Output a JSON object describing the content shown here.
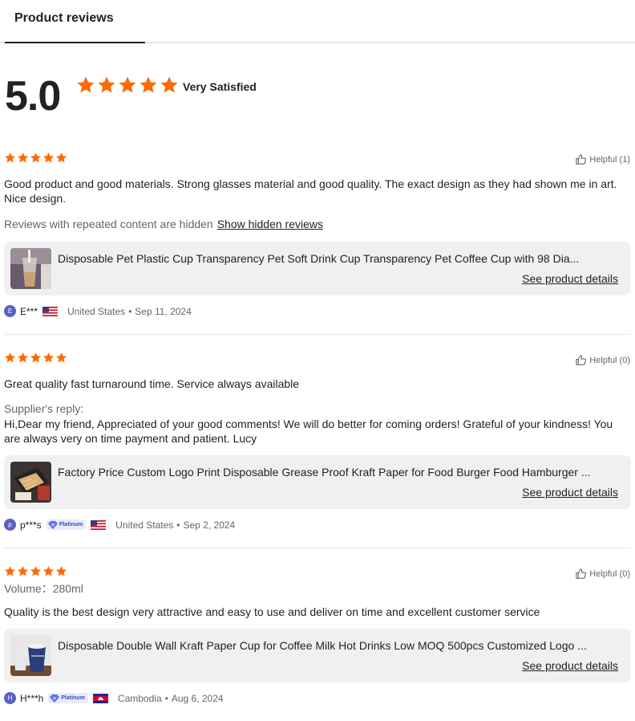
{
  "tabs": {
    "active": "Product reviews"
  },
  "summary": {
    "score": "5.0",
    "stars": 5,
    "label": "Very Satisfied"
  },
  "colors": {
    "star": "#ff6a00",
    "text": "#222222",
    "muted": "#666666",
    "card": "#f0f0f0"
  },
  "reviews": [
    {
      "stars": 5,
      "helpful": "Helpful (1)",
      "text": "Good product and good materials. Strong glasses material and good quality. The exact design as they had shown me in art. Nice design.",
      "hidden_note": "Reviews with repeated content are hidden",
      "hidden_link": "Show hidden reviews",
      "product": {
        "title": "Disposable Pet Plastic Cup Transparency Pet Soft Drink Cup Transparency Pet Coffee Cup with 98 Dia...",
        "link": "See product details"
      },
      "user": {
        "initial": "E",
        "name": "E***",
        "country": "United States",
        "date": "Sep 11, 2024"
      }
    },
    {
      "stars": 5,
      "helpful": "Helpful (0)",
      "text": "Great quality fast turnaround time. Service always available",
      "reply_label": "Supplier's reply:",
      "reply_text": "Hi,Dear my friend, Appreciated of your good comments! We will do better for coming orders! Grateful of your kindness! You are always very on time payment and patient. Lucy",
      "product": {
        "title": "Factory Price Custom Logo Print Disposable Grease Proof Kraft Paper for Food Burger Food Hamburger ...",
        "link": "See product details"
      },
      "user": {
        "initial": "p",
        "name": "p***s",
        "badge": "Platinum",
        "country": "United States",
        "date": "Sep 2, 2024"
      }
    },
    {
      "stars": 5,
      "helpful": "Helpful (0)",
      "variant": "Volume：280ml",
      "text": "Quality is the best design very attractive and easy to use and deliver on time and excellent customer service",
      "product": {
        "title": "Disposable Double Wall Kraft Paper Cup for Coffee Milk Hot Drinks Low MOQ 500pcs Customized Logo ...",
        "link": "See product details"
      },
      "user": {
        "initial": "H",
        "name": "H***h",
        "badge": "Platinum",
        "country": "Cambodia",
        "date": "Aug 6, 2024"
      }
    }
  ]
}
